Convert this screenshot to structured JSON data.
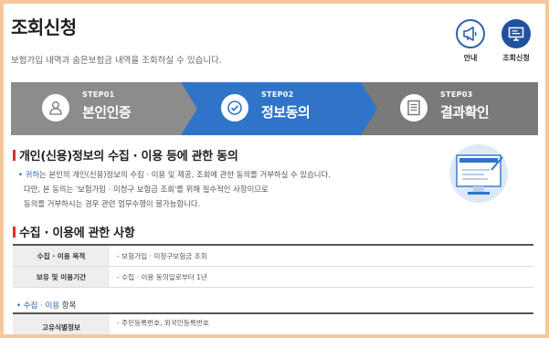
{
  "page": {
    "title": "조회신청",
    "subtitle": "보험가입 내역과 숨은보험금 내역을 조회하실 수 있습니다."
  },
  "header_buttons": [
    {
      "label": "안내",
      "icon": "megaphone-icon"
    },
    {
      "label": "조회신청",
      "icon": "monitor-icon"
    }
  ],
  "steps": [
    {
      "no": "STEP01",
      "name": "본인인증",
      "icon": "person-icon",
      "state": "done"
    },
    {
      "no": "STEP02",
      "name": "정보동의",
      "icon": "check-icon",
      "state": "active"
    },
    {
      "no": "STEP03",
      "name": "결과확인",
      "icon": "document-icon",
      "state": "todo"
    }
  ],
  "consent": {
    "title": "개인(신용)정보의 수집 · 이용 등에 관한 동의",
    "lines": [
      {
        "prefix": "귀하",
        "text": "는 본인의 개인(신용)정보의 수집 · 이용 및 제공, 조회에 관한 동의를 거부하실 수 있습니다."
      },
      {
        "prefix": "",
        "text": "다만, 본 동의는 '보험가입 · 미청구 보험금 조회'를 위해 필수적인 사항이므로"
      },
      {
        "prefix": "",
        "text": "동의를 거부하시는 경우 관련 업무수행이 불가능합니다."
      }
    ]
  },
  "collection": {
    "title": "수집 · 이용에 관한 사항",
    "rows": [
      {
        "label": "수집 · 이용 목적",
        "value": "- 보험가입 · 미청구보험금 조회"
      },
      {
        "label": "보유 및 이용기간",
        "value": "- 수집 · 이용 동의일로부터 1년"
      }
    ],
    "items_heading_hl": "수집 · 이용",
    "items_heading_rest": " 항목",
    "item_rows": [
      {
        "label": "고유식별정보",
        "value": "- 주민등록번호, 외국인등록번호"
      }
    ]
  },
  "colors": {
    "step_done": "#8c8c8c",
    "step_active": "#2f74c9",
    "step_todo": "#7a7a7a",
    "accent_red": "#d8322a",
    "accent_blue": "#2b63b0",
    "outer_frame": "#f5c79a"
  }
}
